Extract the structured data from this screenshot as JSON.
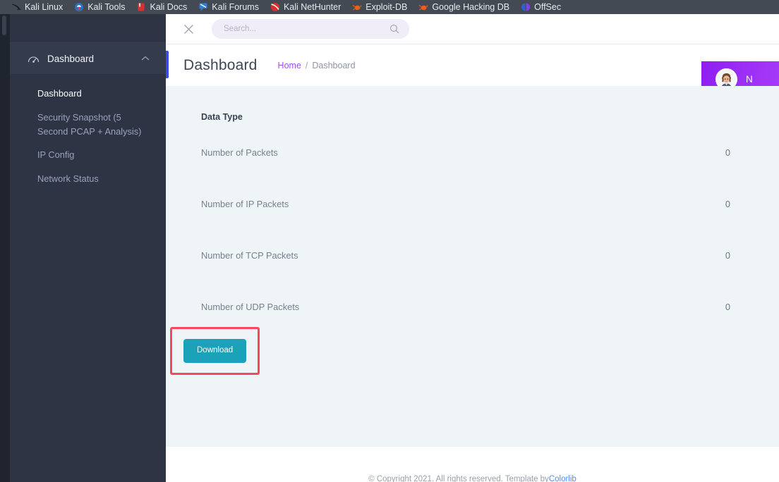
{
  "browser": {
    "bookmarks": [
      {
        "label": "Kali Linux",
        "icon": "kali-dragon-icon"
      },
      {
        "label": "Kali Tools",
        "icon": "kali-tools-icon"
      },
      {
        "label": "Kali Docs",
        "icon": "kali-docs-icon"
      },
      {
        "label": "Kali Forums",
        "icon": "kali-forums-icon"
      },
      {
        "label": "Kali NetHunter",
        "icon": "kali-nethunter-icon"
      },
      {
        "label": "Exploit-DB",
        "icon": "exploit-db-icon"
      },
      {
        "label": "Google Hacking DB",
        "icon": "google-hacking-db-icon"
      },
      {
        "label": "OffSec",
        "icon": "offsec-icon"
      }
    ]
  },
  "sidebar": {
    "menu": {
      "label": "Dashboard",
      "icon": "speedometer-icon",
      "chevron": "chevron-up-icon",
      "expanded": true
    },
    "items": [
      {
        "label": "Dashboard",
        "active": true
      },
      {
        "label": "Security Snapshot (5 Second PCAP + Analysis)",
        "active": false
      },
      {
        "label": "IP Config",
        "active": false
      },
      {
        "label": "Network Status",
        "active": false
      }
    ]
  },
  "topbar": {
    "close_icon": "close-icon",
    "search": {
      "value": "",
      "placeholder": "Search...",
      "icon": "search-icon"
    }
  },
  "header": {
    "title": "Dashboard",
    "breadcrumb": {
      "home": "Home",
      "separator": "/",
      "current": "Dashboard"
    },
    "user": {
      "name": "N",
      "avatar": "user-avatar"
    },
    "accent_color": "#3d4ae8"
  },
  "table": {
    "columns": [
      "Data Type",
      ""
    ],
    "rows": [
      {
        "label": "Number of Packets",
        "value": "0"
      },
      {
        "label": "Number of IP Packets",
        "value": "0"
      },
      {
        "label": "Number of TCP Packets",
        "value": "0"
      },
      {
        "label": "Number of UDP Packets",
        "value": "0"
      }
    ]
  },
  "actions": {
    "download_label": "Download",
    "download_color": "#1aa3b8",
    "highlight_color": "#f8485e"
  },
  "footer": {
    "text": "© Copyright 2021. All rights reserved. Template by ",
    "link": "Colorlib"
  }
}
